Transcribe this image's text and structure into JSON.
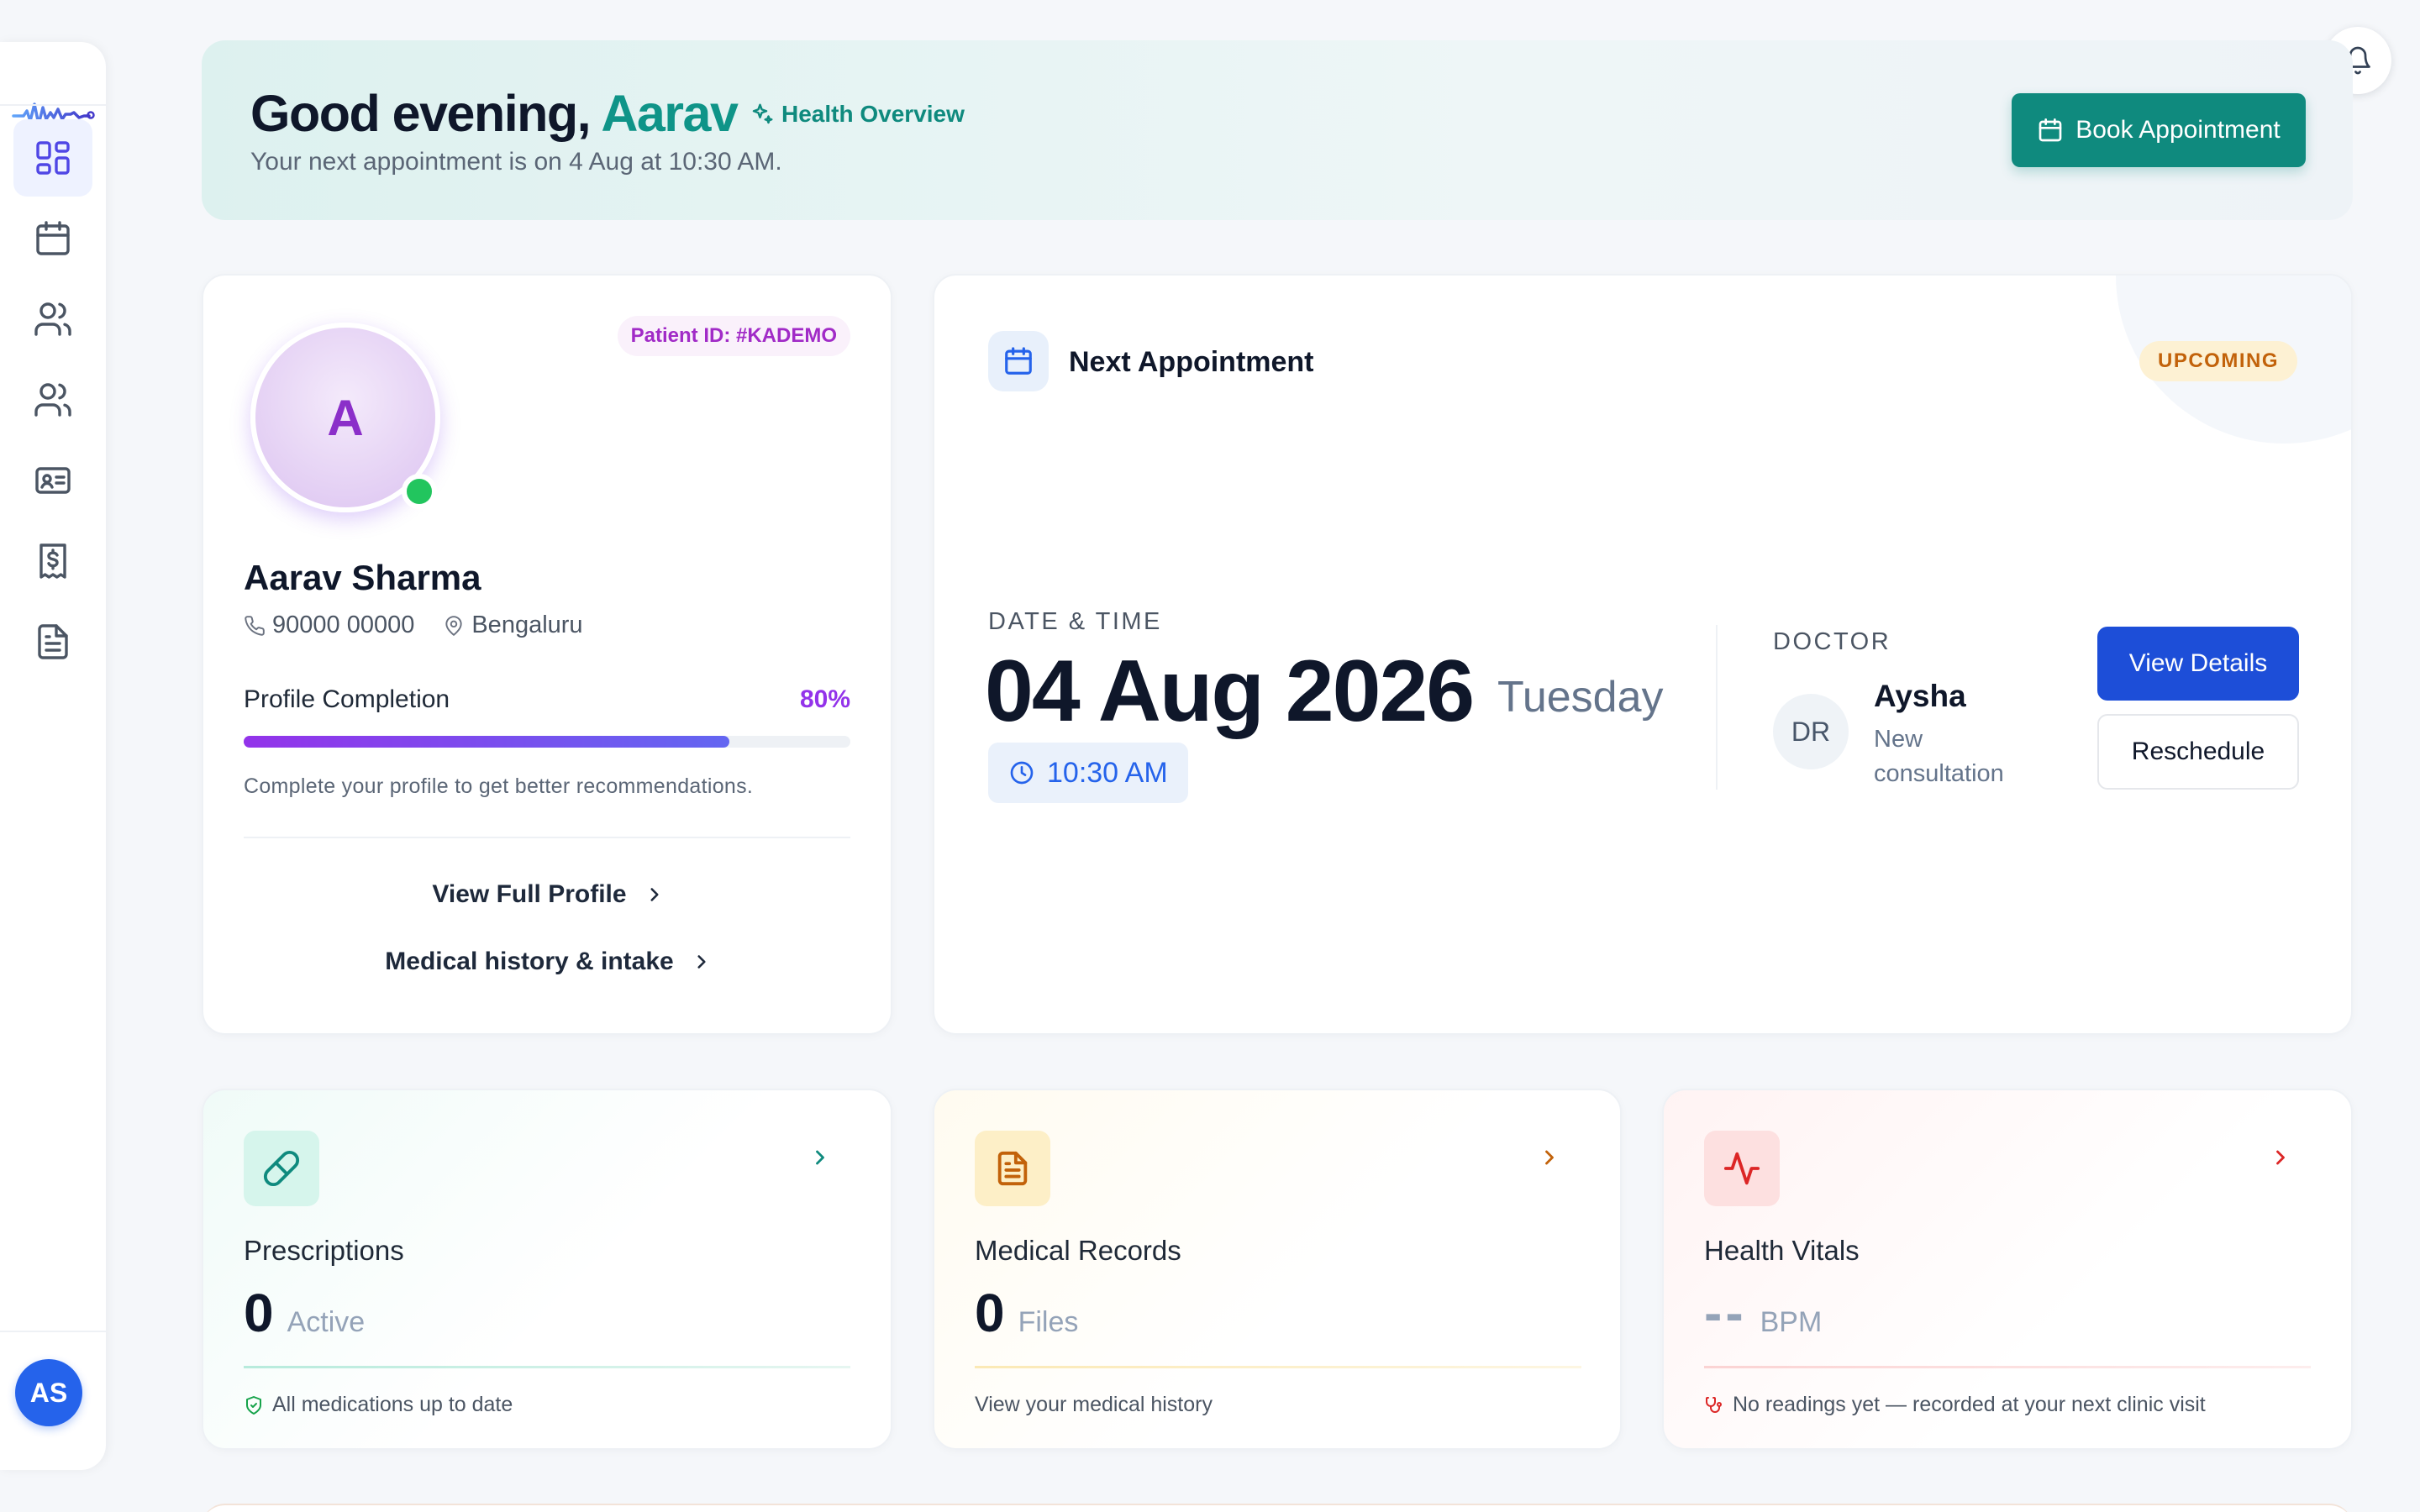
{
  "sidebar": {
    "logo": "wave-logo",
    "items": [
      {
        "name": "dashboard",
        "icon": "grid-icon",
        "active": true
      },
      {
        "name": "appointments",
        "icon": "calendar-icon",
        "active": false
      },
      {
        "name": "doctors",
        "icon": "users-icon",
        "active": false
      },
      {
        "name": "family",
        "icon": "users-icon",
        "active": false
      },
      {
        "name": "id-card",
        "icon": "id-card-icon",
        "active": false
      },
      {
        "name": "billing",
        "icon": "receipt-icon",
        "active": false
      },
      {
        "name": "documents",
        "icon": "file-text-icon",
        "active": false
      }
    ],
    "user_initials": "AS"
  },
  "header": {
    "greeting": "Good evening,",
    "user_name": "Aarav",
    "tag": "Health Overview",
    "subtitle": "Your next appointment is on 4 Aug at 10:30 AM.",
    "book_button": "Book Appointment"
  },
  "profile": {
    "patient_id": "Patient ID: #KADEMO",
    "avatar_initial": "A",
    "name": "Aarav Sharma",
    "phone": "90000 00000",
    "location": "Bengaluru",
    "completion_label": "Profile Completion",
    "completion_pct_text": "80%",
    "completion_fraction": 0.8,
    "completion_hint": "Complete your profile to get better recommendations.",
    "link_full_profile": "View Full Profile",
    "link_medical_history": "Medical history & intake"
  },
  "appointment": {
    "title": "Next Appointment",
    "status": "UPCOMING",
    "datetime_label": "DATE & TIME",
    "date": "04 Aug 2026",
    "day": "Tuesday",
    "time": "10:30 AM",
    "doctor_label": "DOCTOR",
    "doctor_initials": "DR",
    "doctor_name": "Aysha",
    "consult_type": "New consultation",
    "view_button": "View Details",
    "reschedule_button": "Reschedule"
  },
  "stats": {
    "prescriptions": {
      "title": "Prescriptions",
      "value": "0",
      "unit": "Active",
      "footer": "All medications up to date"
    },
    "records": {
      "title": "Medical Records",
      "value": "0",
      "unit": "Files",
      "footer": "View your medical history"
    },
    "vitals": {
      "title": "Health Vitals",
      "value": "--",
      "unit": "BPM",
      "footer": "No readings yet — recorded at your next clinic visit"
    }
  },
  "colors": {
    "accent_teal": "#0f8a7e",
    "accent_blue": "#1d4ed8",
    "accent_purple": "#9333ea",
    "status_amber": "#c2620a",
    "vitals_red": "#dc2626"
  }
}
